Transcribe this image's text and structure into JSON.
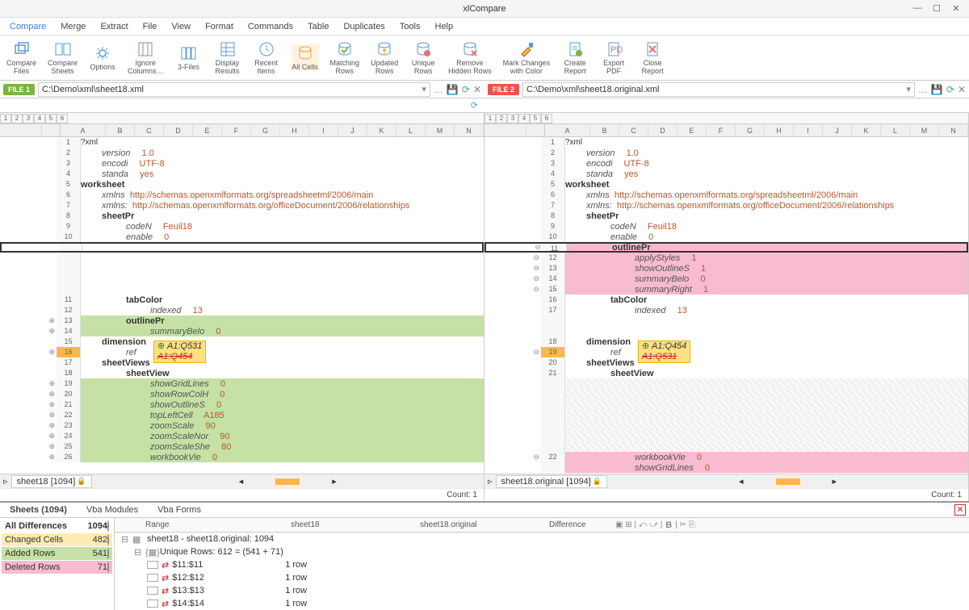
{
  "app": {
    "title": "xlCompare"
  },
  "window_btns": {
    "min": "—",
    "max": "☐",
    "close": "✕"
  },
  "menu": [
    "Compare",
    "Merge",
    "Extract",
    "File",
    "View",
    "Format",
    "Commands",
    "Table",
    "Duplicates",
    "Tools",
    "Help"
  ],
  "ribbon": [
    {
      "label": "Compare\nFiles",
      "icon": "layers"
    },
    {
      "label": "Compare\nSheets",
      "icon": "sheets"
    },
    {
      "label": "Options",
      "icon": "gear"
    },
    {
      "label": "Ignore\nColumns…",
      "icon": "ignore"
    },
    {
      "label": "3-Files",
      "icon": "three"
    },
    {
      "label": "Display\nResults",
      "icon": "grid"
    },
    {
      "label": "Recent\nItems",
      "icon": "clock"
    },
    {
      "label": "All Cells",
      "icon": "db",
      "hi": true
    },
    {
      "label": "Matching\nRows",
      "icon": "dbm"
    },
    {
      "label": "Updated\nRows",
      "icon": "dbu"
    },
    {
      "label": "Unique\nRows",
      "icon": "dbx"
    },
    {
      "label": "Remove\nHidden Rows",
      "icon": "dbr"
    },
    {
      "label": "Mark Changes\nwith Color",
      "icon": "brush"
    },
    {
      "label": "Create\nReport",
      "icon": "doc"
    },
    {
      "label": "Export\nPDF",
      "icon": "pdf"
    },
    {
      "label": "Close\nReport",
      "icon": "closerep"
    }
  ],
  "file1": {
    "badge": "FILE 1",
    "path": "C:\\Demo\\xml\\sheet18.xml"
  },
  "file2": {
    "badge": "FILE 2",
    "path": "C:\\Demo\\xml\\sheet18.original.xml"
  },
  "numtabs": [
    "1",
    "2",
    "3",
    "4",
    "5",
    "6"
  ],
  "cols": [
    "A",
    "B",
    "C",
    "D",
    "E",
    "F",
    "G",
    "H",
    "I",
    "J",
    "K",
    "L",
    "M",
    "N"
  ],
  "left_rows": [
    {
      "n": "1",
      "t": "?xml",
      "cls": ""
    },
    {
      "n": "2",
      "t": "version",
      "v": "1.0",
      "ind": 1,
      "key": true
    },
    {
      "n": "3",
      "t": "encodi",
      "v": "UTF-8",
      "ind": 1,
      "key": true
    },
    {
      "n": "4",
      "t": "standa",
      "v": "yes",
      "ind": 1,
      "key": true
    },
    {
      "n": "5",
      "t": "worksheet",
      "cls": "",
      "b": true
    },
    {
      "n": "6",
      "t": "xmlns",
      "v": "http://schemas.openxmlformats.org/spreadsheetml/2006/main",
      "ind": 1,
      "key": true,
      "link": true
    },
    {
      "n": "7",
      "t": "xmlns:",
      "v": "http://schemas.openxmlformats.org/officeDocument/2006/relationships",
      "ind": 1,
      "key": true,
      "link": true
    },
    {
      "n": "8",
      "t": "sheetPr",
      "ind": 1,
      "b": true
    },
    {
      "n": "9",
      "t": "codeN",
      "v": "Feuil18",
      "ind": 2,
      "key": true
    },
    {
      "n": "10",
      "t": "enable",
      "v": "0",
      "ind": 2,
      "key": true
    },
    {
      "n": "",
      "t": "",
      "sel": true
    },
    {
      "n": "",
      "t": ""
    },
    {
      "n": "",
      "t": ""
    },
    {
      "n": "",
      "t": ""
    },
    {
      "n": "",
      "t": ""
    },
    {
      "n": "11",
      "t": "tabColor",
      "ind": 2,
      "b": true
    },
    {
      "n": "12",
      "t": "indexed",
      "v": "13",
      "ind": 3,
      "key": true
    },
    {
      "n": "13",
      "t": "outlinePr",
      "ind": 2,
      "b": true,
      "bg": "green",
      "gut": "⊕"
    },
    {
      "n": "14",
      "t": "summaryBelo",
      "v": "0",
      "ind": 3,
      "key": true,
      "bg": "green",
      "gut": "⊕"
    },
    {
      "n": "15",
      "t": "dimension",
      "ind": 1,
      "b": true
    },
    {
      "n": "16",
      "t": "ref",
      "ind": 2,
      "key": true,
      "yellow": [
        "A1:Q531",
        "A1:Q454"
      ],
      "hi": true,
      "gut": "⊕"
    },
    {
      "n": "17",
      "t": "sheetViews",
      "ind": 1,
      "b": true
    },
    {
      "n": "18",
      "t": "sheetView",
      "ind": 2,
      "b": true,
      "bgstart": "green"
    },
    {
      "n": "19",
      "t": "showGridLines",
      "v": "0",
      "ind": 3,
      "key": true,
      "bg": "green",
      "gut": "⊕"
    },
    {
      "n": "20",
      "t": "showRowColH",
      "v": "0",
      "ind": 3,
      "key": true,
      "bg": "green",
      "gut": "⊕"
    },
    {
      "n": "21",
      "t": "showOutlineS",
      "v": "0",
      "ind": 3,
      "key": true,
      "bg": "green",
      "gut": "⊕"
    },
    {
      "n": "22",
      "t": "topLeftCell",
      "v": "A185",
      "ind": 3,
      "key": true,
      "bg": "green",
      "gut": "⊕"
    },
    {
      "n": "23",
      "t": "zoomScale",
      "v": "90",
      "ind": 3,
      "key": true,
      "bg": "green",
      "gut": "⊕"
    },
    {
      "n": "24",
      "t": "zoomScaleNor",
      "v": "90",
      "ind": 3,
      "key": true,
      "bg": "green",
      "gut": "⊕"
    },
    {
      "n": "25",
      "t": "zoomScaleShe",
      "v": "80",
      "ind": 3,
      "key": true,
      "bg": "green",
      "gut": "⊕"
    },
    {
      "n": "26",
      "t": "workbookVie",
      "v": "0",
      "ind": 3,
      "key": true,
      "bg": "green",
      "gut": "⊕"
    }
  ],
  "right_rows": [
    {
      "n": "1",
      "t": "?xml"
    },
    {
      "n": "2",
      "t": "version",
      "v": "1.0",
      "ind": 1,
      "key": true
    },
    {
      "n": "3",
      "t": "encodi",
      "v": "UTF-8",
      "ind": 1,
      "key": true
    },
    {
      "n": "4",
      "t": "standa",
      "v": "yes",
      "ind": 1,
      "key": true
    },
    {
      "n": "5",
      "t": "worksheet",
      "b": true
    },
    {
      "n": "6",
      "t": "xmlns",
      "v": "http://schemas.openxmlformats.org/spreadsheetml/2006/main",
      "ind": 1,
      "key": true,
      "link": true
    },
    {
      "n": "7",
      "t": "xmlns:",
      "v": "http://schemas.openxmlformats.org/officeDocument/2006/relationships",
      "ind": 1,
      "key": true,
      "link": true
    },
    {
      "n": "8",
      "t": "sheetPr",
      "ind": 1,
      "b": true
    },
    {
      "n": "9",
      "t": "codeN",
      "v": "Feuil18",
      "ind": 2,
      "key": true
    },
    {
      "n": "10",
      "t": "enable",
      "v": "0",
      "ind": 2,
      "key": true
    },
    {
      "n": "11",
      "t": "outlinePr",
      "ind": 2,
      "b": true,
      "bg": "pink",
      "sel": true,
      "gut": "⊖"
    },
    {
      "n": "12",
      "t": "applyStyles",
      "v": "1",
      "ind": 3,
      "key": true,
      "bg": "pink",
      "gut": "⊖"
    },
    {
      "n": "13",
      "t": "showOutlineS",
      "v": "1",
      "ind": 3,
      "key": true,
      "bg": "pink",
      "gut": "⊖"
    },
    {
      "n": "14",
      "t": "summaryBelo",
      "v": "0",
      "ind": 3,
      "key": true,
      "bg": "pink",
      "gut": "⊖"
    },
    {
      "n": "15",
      "t": "summaryRight",
      "v": "1",
      "ind": 3,
      "key": true,
      "bg": "pink",
      "gut": "⊖"
    },
    {
      "n": "16",
      "t": "tabColor",
      "ind": 2,
      "b": true
    },
    {
      "n": "17",
      "t": "indexed",
      "v": "13",
      "ind": 3,
      "key": true
    },
    {
      "n": "",
      "t": ""
    },
    {
      "n": "",
      "t": ""
    },
    {
      "n": "18",
      "t": "dimension",
      "ind": 1,
      "b": true
    },
    {
      "n": "19",
      "t": "ref",
      "ind": 2,
      "key": true,
      "yellow": [
        "A1:Q454",
        "A1:Q531"
      ],
      "hi": true,
      "gut": "⊖"
    },
    {
      "n": "20",
      "t": "sheetViews",
      "ind": 1,
      "b": true
    },
    {
      "n": "21",
      "t": "sheetView",
      "ind": 2,
      "b": true
    },
    {
      "n": "",
      "t": "",
      "hatch": true
    },
    {
      "n": "",
      "t": "",
      "hatch": true
    },
    {
      "n": "",
      "t": "",
      "hatch": true
    },
    {
      "n": "",
      "t": "",
      "hatch": true
    },
    {
      "n": "",
      "t": "",
      "hatch": true
    },
    {
      "n": "",
      "t": "",
      "hatch": true
    },
    {
      "n": "",
      "t": "",
      "hatch": true
    },
    {
      "n": "22",
      "t": "workbookVie",
      "v": "0",
      "ind": 3,
      "key": true,
      "bg": "pink",
      "gut": "⊖"
    },
    {
      "n": "",
      "t": "showGridLines",
      "v": "0",
      "ind": 3,
      "key": true,
      "bg": "pink"
    }
  ],
  "sheet_tab_left": "sheet18 [1094]",
  "sheet_tab_right": "sheet18.original [1094]",
  "count_label": "Count: 1",
  "bottom_tabs": [
    "Sheets (1094)",
    "Vba Modules",
    "Vba Forms"
  ],
  "summary": {
    "head": {
      "label": "All Differences",
      "n": "1094"
    },
    "chg": {
      "label": "Changed Cells",
      "n": "482"
    },
    "add": {
      "label": "Added Rows",
      "n": "541"
    },
    "del": {
      "label": "Deleted Rows",
      "n": "71"
    }
  },
  "diff_head": [
    "Range",
    "sheet18",
    "sheet18.original",
    "Difference"
  ],
  "diff_rows": [
    {
      "exp": "⊟",
      "ico": "▦",
      "text": "sheet18 - sheet18.original: 1094"
    },
    {
      "exp": "⊟",
      "ico": "{▦}",
      "text": "Unique Rows: 612 = (541 + 71)",
      "pad": 1
    },
    {
      "chk": true,
      "arrow": "⇄",
      "r": "$11:$11",
      "v": "1 row",
      "pad": 2
    },
    {
      "chk": true,
      "arrow": "⇄",
      "r": "$12:$12",
      "v": "1 row",
      "pad": 2
    },
    {
      "chk": true,
      "arrow": "⇄",
      "r": "$13:$13",
      "v": "1 row",
      "pad": 2
    },
    {
      "chk": true,
      "arrow": "⇄",
      "r": "$14:$14",
      "v": "1 row",
      "pad": 2
    }
  ]
}
